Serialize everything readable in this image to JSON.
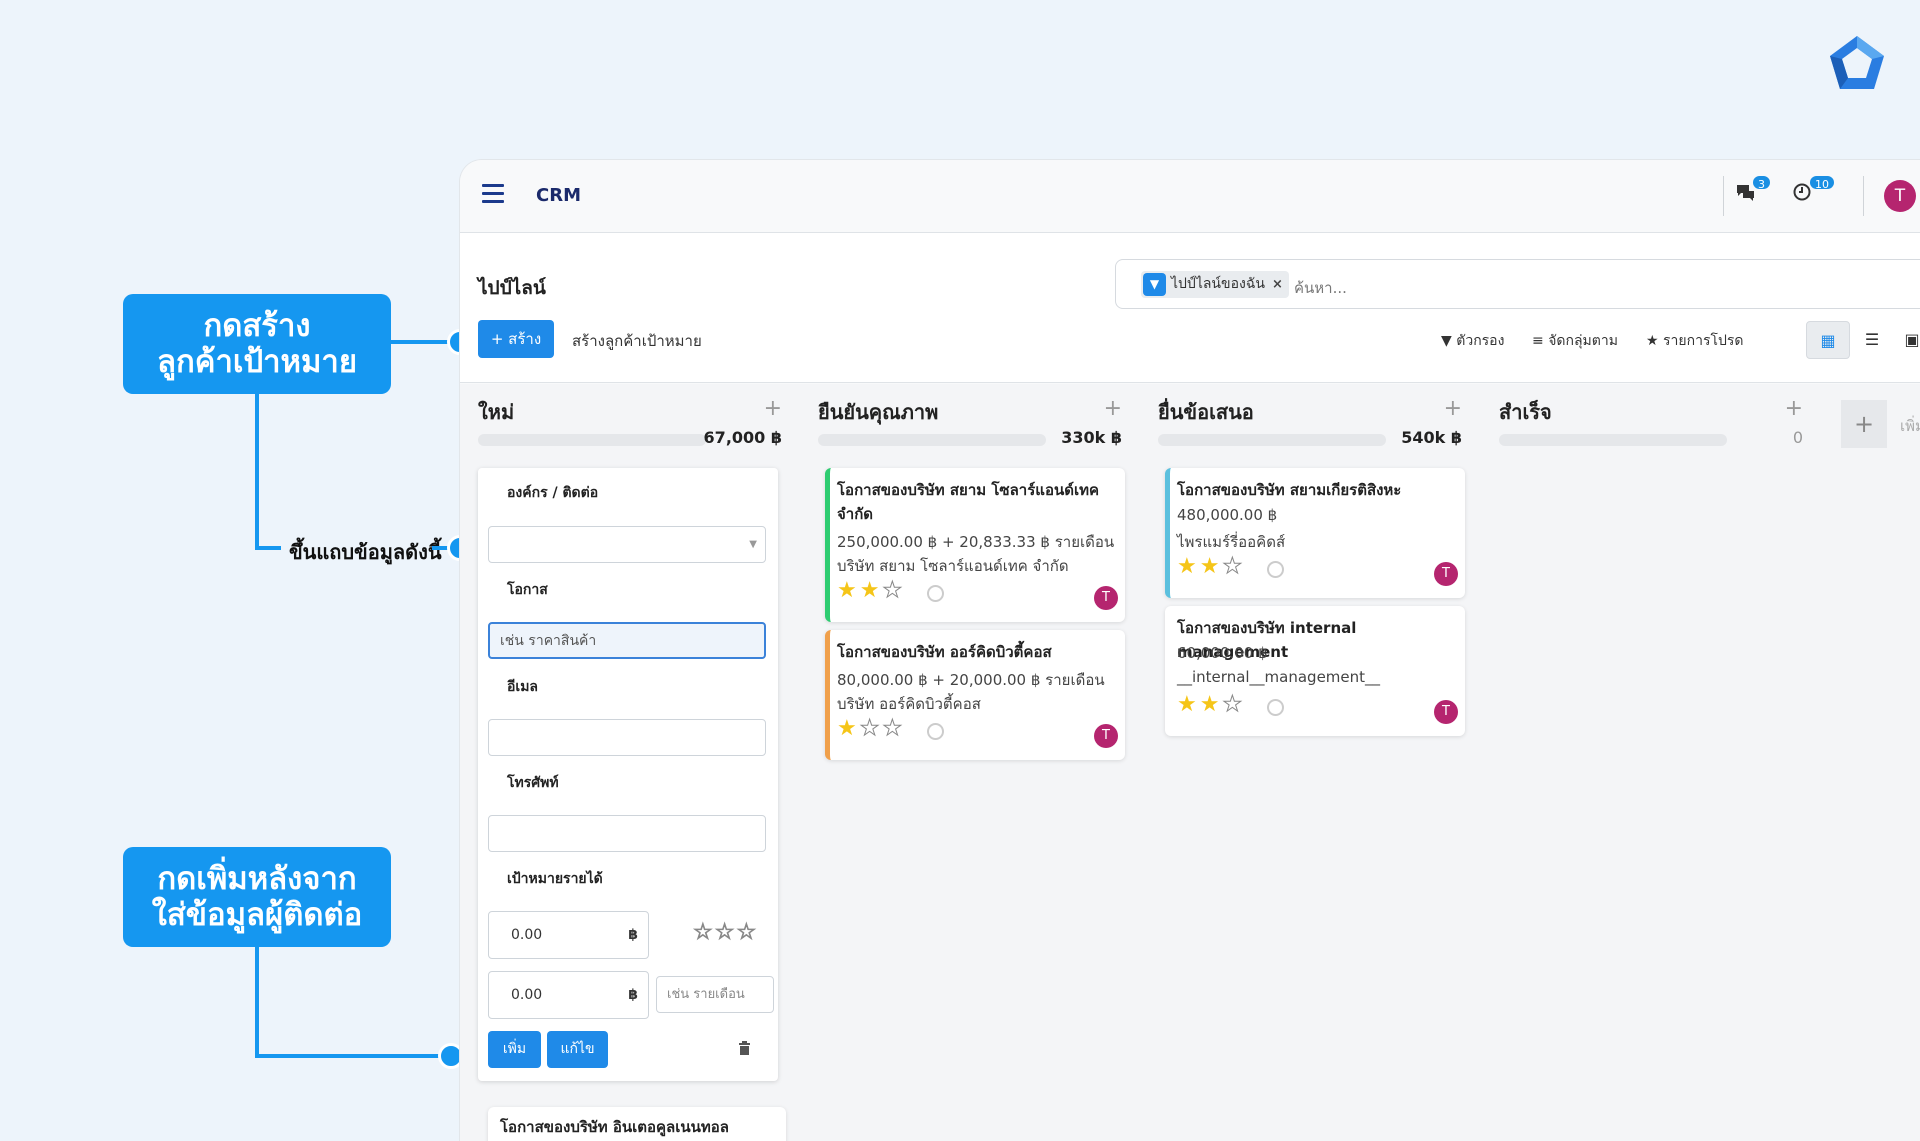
{
  "annotations": {
    "create_target": [
      "กดสร้าง",
      "ลูกค้าเป้าหมาย"
    ],
    "form_appears": "ขึ้นแถบข้อมูลดังนี้",
    "add_after": [
      "กดเพิ่มหลังจาก",
      "ใส่ข้อมูลผู้ติดต่อ"
    ]
  },
  "navbar": {
    "app_name": "CRM",
    "messages_count": "3",
    "activities_count": "10",
    "avatar_initial": "T"
  },
  "control_panel": {
    "breadcrumb": "ไปป์ไลน์",
    "create_label": "+ สร้าง",
    "generate_leads_label": "สร้างลูกค้าเป้าหมาย",
    "search": {
      "facet": "ไปป์ไลน์ของฉัน",
      "facet_remove": "×",
      "placeholder": "ค้นหา..."
    },
    "filters_label": "ตัวกรอง",
    "group_by_label": "จัดกลุ่มตาม",
    "favorites_label": "รายการโปรด"
  },
  "kanban": {
    "columns": [
      {
        "title": "ใหม่",
        "total": "67,000 ฿"
      },
      {
        "title": "ยืนยันคุณภาพ",
        "total": "330k ฿"
      },
      {
        "title": "ยื่นข้อเสนอ",
        "total": "540k ฿"
      },
      {
        "title": "สำเร็จ",
        "total": "0"
      }
    ],
    "add_column_label": "เพิ่ม",
    "quick_create": {
      "org_label": "องค์กร / ติดต่อ",
      "opportunity_label": "โอกาส",
      "opportunity_placeholder": "เช่น ราคาสินค้า",
      "email_label": "อีเมล",
      "phone_label": "โทรศัพท์",
      "revenue_label": "เป้าหมายรายได้",
      "revenue_value": "0.00",
      "recurring_value": "0.00",
      "currency": "฿",
      "recurring_placeholder": "เช่น รายเดือน",
      "add_button": "เพิ่ม",
      "edit_button": "แก้ไข"
    },
    "cards": [
      {
        "title": "โอกาสของบริษัท สยาม โซลาร์แอนด์เทค จำกัด",
        "line1": "250,000.00 ฿ + 20,833.33 ฿ รายเดือน",
        "line2": "บริษัท สยาม โซลาร์แอนด์เทค จำกัด",
        "stars": 2,
        "avatar": "T",
        "accent": "#2ecc71"
      },
      {
        "title": "โอกาสของบริษัท ออร์คิดบิวตี้คอส",
        "line1": "80,000.00 ฿ + 20,000.00 ฿ รายเดือน",
        "line2": "บริษัท ออร์คิดบิวตี้คอส",
        "stars": 1,
        "avatar": "T",
        "accent": "#f0a04b"
      },
      {
        "title": "โอกาสของบริษัท สยามเกียรติสิงหะ",
        "line1": "480,000.00 ฿",
        "line2": "ไพรแมร์รี่ออคิดส์",
        "stars": 2,
        "avatar": "T",
        "accent": "#5bc0de"
      },
      {
        "title": "โอกาสของบริษัท internal management",
        "line1": "60,000.00 ฿",
        "line2": "__internal__management__",
        "stars": 2,
        "avatar": "T",
        "accent": "transparent"
      },
      {
        "title": "โอกาสของบริษัท อินเตอคูลเนนทอล"
      }
    ]
  }
}
